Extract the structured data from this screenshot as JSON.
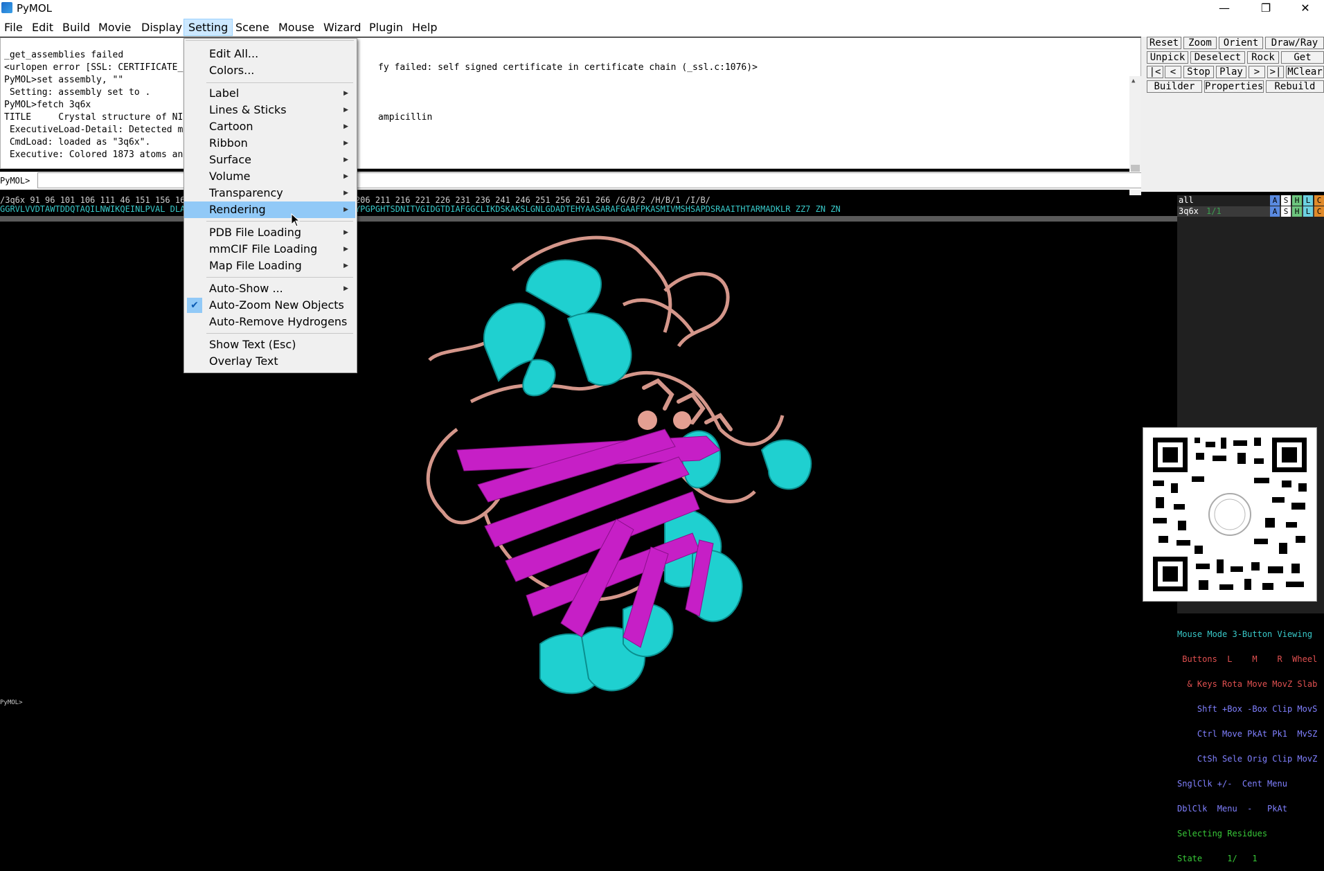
{
  "window": {
    "title": "PyMOL",
    "minimize": "—",
    "restore": "❐",
    "close": "✕"
  },
  "menubar": [
    "File",
    "Edit",
    "Build",
    "Movie",
    "Display",
    "Setting",
    "Scene",
    "Mouse",
    "Wizard",
    "Plugin",
    "Help"
  ],
  "console": [
    "_get_assemblies failed",
    "<urlopen error [SSL: CERTIFICATE_                                    fy failed: self signed certificate in certificate chain (_ssl.c:1076)>",
    "PyMOL>set assembly, \"\"",
    " Setting: assembly set to .",
    "PyMOL>fetch 3q6x",
    "TITLE     Crystal structure of NI                                    ampicillin",
    " ExecutiveLoad-Detail: Detected m",
    " CmdLoad: loaded as \"3q6x\".",
    " Executive: Colored 1873 atoms an"
  ],
  "command": {
    "prompt": "PyMOL>",
    "value": ""
  },
  "buttons": {
    "row1": [
      "Reset",
      "Zoom",
      "Orient",
      "Draw/Ray ▾"
    ],
    "row2": [
      "Unpick",
      "Deselect",
      "Rock",
      "Get View"
    ],
    "row3": [
      "|<",
      "<",
      "Stop",
      "Play",
      ">",
      ">|",
      "MClear"
    ],
    "row4": [
      "Builder",
      "Properties",
      "Rebuild"
    ]
  },
  "sequence": {
    "numbers": "/3q6x    91    96   101   106   111                                         46   151   156   161   166   171   176   181   186   191   196   201   206   211   216   221   226   231   236   241   246   251   256   261   266  /G/B/2    /H/B/1   /I/B/",
    "residues": "GGRVLVVDTAWTDDQTAQILNWIKQEINLPVAL                                         DLAPQEGMVAAQHSLTFAANGWVEPATAPNFGPLKVFYPGPGHTSDNITVGIDGTDIAFGGCLIKDSKAKSLGNLGDADTEHYAASARAFGAAFPKASMIVMSHSAPDSRAAITHTARMADKLR      ZZ7        ZN        ZN"
  },
  "objects": [
    {
      "name": "all",
      "flags": [
        "A",
        "S",
        "H",
        "L",
        "C"
      ]
    },
    {
      "name": "3q6x",
      "state": "1/1",
      "flags": [
        "A",
        "S",
        "H",
        "L",
        "C"
      ]
    }
  ],
  "menu_setting": {
    "items": [
      {
        "label": "Edit All...",
        "submenu": false
      },
      {
        "label": "Colors...",
        "submenu": false
      },
      {
        "label": "Label",
        "submenu": true
      },
      {
        "label": "Lines & Sticks",
        "submenu": true
      },
      {
        "label": "Cartoon",
        "submenu": true
      },
      {
        "label": "Ribbon",
        "submenu": true
      },
      {
        "label": "Surface",
        "submenu": true
      },
      {
        "label": "Volume",
        "submenu": true
      },
      {
        "label": "Transparency",
        "submenu": true
      },
      {
        "label": "Rendering",
        "submenu": true,
        "highlighted": true
      },
      {
        "label": "PDB File Loading",
        "submenu": true
      },
      {
        "label": "mmCIF File Loading",
        "submenu": true
      },
      {
        "label": "Map File Loading",
        "submenu": true
      },
      {
        "label": "Auto-Show ...",
        "submenu": true
      },
      {
        "label": "Auto-Zoom New Objects",
        "submenu": false,
        "checked": true
      },
      {
        "label": "Auto-Remove Hydrogens",
        "submenu": false
      },
      {
        "label": "Show Text (Esc)",
        "submenu": false
      },
      {
        "label": "Overlay Text",
        "submenu": false
      }
    ]
  },
  "legend": {
    "line1": "Mouse Mode 3-Button Viewing",
    "line2": " Buttons  L    M    R  Wheel",
    "line3": "  & Keys Rota Move MovZ Slab",
    "line4": "    Shft +Box -Box Clip MovS",
    "line5": "    Ctrl Move PkAt Pk1  MvSZ",
    "line6": "    CtSh Sele Orig Clip MovZ",
    "line7": "SnglClk +/-  Cent Menu",
    "line8": "DblClk  Menu  -   PkAt",
    "line9": "Selecting Residues",
    "line10": "State     1/   1"
  },
  "bottom_prompt": "PyMOL>",
  "colors": {
    "cyan": "#1fd0d0",
    "magenta": "#c61fc6",
    "salmon": "#d4968a",
    "menu_highlight": "#91c9f7"
  }
}
